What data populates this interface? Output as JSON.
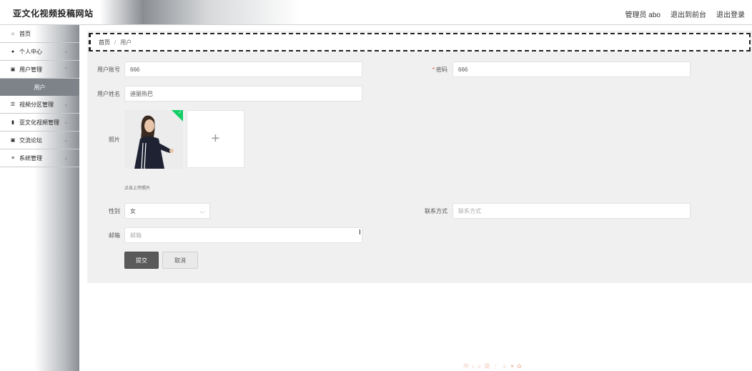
{
  "header": {
    "site_title": "亚文化视频投稿网站",
    "admin_label": "管理员 abo",
    "to_front": "退出到前台",
    "logout": "退出登录"
  },
  "sidebar": {
    "items": [
      {
        "label": "首页",
        "icon": "home-icon",
        "glyph": "⌂"
      },
      {
        "label": "个人中心",
        "icon": "user-icon",
        "glyph": "●"
      },
      {
        "label": "用户管理",
        "icon": "clipboard-icon",
        "glyph": "▣"
      },
      {
        "label": "视频分区管理",
        "icon": "sliders-icon",
        "glyph": "☰"
      },
      {
        "label": "亚文化视频管理",
        "icon": "bar-chart-icon",
        "glyph": "▮"
      },
      {
        "label": "交流论坛",
        "icon": "chat-icon",
        "glyph": "▣"
      },
      {
        "label": "系统管理",
        "icon": "list-icon",
        "glyph": "≡"
      }
    ],
    "active_sub": "用户"
  },
  "breadcrumb": {
    "home": "首页",
    "separator": "/",
    "current": "用户"
  },
  "form": {
    "account_label": "用户账号",
    "account_value": "666",
    "password_label": "密码",
    "password_value": "666",
    "name_label": "用户姓名",
    "name_value": "迪丽热巴",
    "photo_label": "照片",
    "photo_add": "+",
    "photo_tip": "点击上传照片",
    "gender_label": "性别",
    "gender_value": "女",
    "contact_label": "联系方式",
    "contact_placeholder": "联系方式",
    "email_label": "邮箱",
    "email_placeholder": "邮箱",
    "submit": "提交",
    "cancel": "取消"
  },
  "colors": {
    "accent": "#5a5a5a",
    "sidebar_active": "#7e8389",
    "success": "#13ce66",
    "required": "#e63c3c"
  },
  "watermark": "中 ⸗ ♫ 简 ⋮ ☺ ♥ ✿"
}
